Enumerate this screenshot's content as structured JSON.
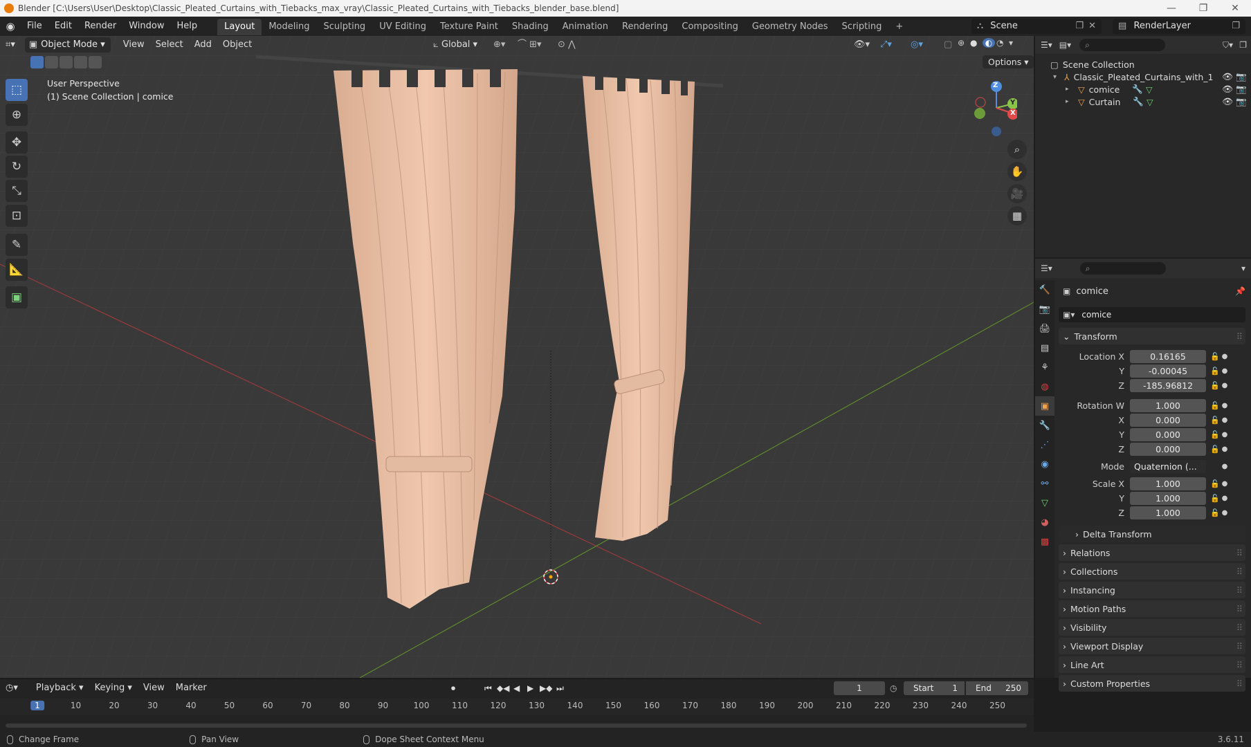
{
  "titlebar": {
    "title": "Blender [C:\\Users\\User\\Desktop\\Classic_Pleated_Curtains_with_Tiebacks_max_vray\\Classic_Pleated_Curtains_with_Tiebacks_blender_base.blend]",
    "minimize": "—",
    "maximize": "❐",
    "close": "✕"
  },
  "menu": [
    "File",
    "Edit",
    "Render",
    "Window",
    "Help"
  ],
  "workspaces": [
    "Layout",
    "Modeling",
    "Sculpting",
    "UV Editing",
    "Texture Paint",
    "Shading",
    "Animation",
    "Rendering",
    "Compositing",
    "Geometry Nodes",
    "Scripting"
  ],
  "workspace_add": "+",
  "scene": {
    "name": "Scene",
    "render_layer": "RenderLayer"
  },
  "viewport": {
    "mode": "Object Mode",
    "menus": [
      "View",
      "Select",
      "Add",
      "Object"
    ],
    "transform_orientation": "Global",
    "options": "Options",
    "overlay_line1": "User Perspective",
    "overlay_line2": "(1) Scene Collection | comice",
    "gizmo": {
      "z": "Z",
      "y": "Y",
      "x": "X"
    }
  },
  "outliner": {
    "root": "Scene Collection",
    "collection": "Classic_Pleated_Curtains_with_1",
    "objects": [
      "comice",
      "Curtain"
    ]
  },
  "properties": {
    "object_name": "comice",
    "data_name": "comice",
    "transform_header": "Transform",
    "location": {
      "label": "Location X",
      "x": "0.16165",
      "y": "-0.00045",
      "z": "-185.96812"
    },
    "rotation": {
      "label": "Rotation W",
      "w": "1.000",
      "x": "0.000",
      "y": "0.000",
      "z": "0.000"
    },
    "mode_label": "Mode",
    "mode_value": "Quaternion (...",
    "scale": {
      "label": "Scale X",
      "x": "1.000",
      "y": "1.000",
      "z": "1.000"
    },
    "axis_y": "Y",
    "axis_x": "X",
    "axis_z": "Z",
    "delta_transform": "Delta Transform",
    "sections": [
      "Relations",
      "Collections",
      "Instancing",
      "Motion Paths",
      "Visibility",
      "Viewport Display",
      "Line Art",
      "Custom Properties"
    ]
  },
  "timeline": {
    "menus": [
      "Playback",
      "Keying",
      "View",
      "Marker"
    ],
    "current_frame": "1",
    "start_label": "Start",
    "start": "1",
    "end_label": "End",
    "end": "250",
    "ticks": [
      "1",
      "10",
      "20",
      "30",
      "40",
      "50",
      "60",
      "70",
      "80",
      "90",
      "100",
      "110",
      "120",
      "130",
      "140",
      "150",
      "160",
      "170",
      "180",
      "190",
      "200",
      "210",
      "220",
      "230",
      "240",
      "250"
    ]
  },
  "status": {
    "items": [
      "Change Frame",
      "Pan View",
      "Dope Sheet Context Menu"
    ],
    "version": "3.6.11"
  },
  "colors": {
    "accent": "#4772b3",
    "orange": "#e87d0d",
    "curtain": "#e6c0a6"
  }
}
